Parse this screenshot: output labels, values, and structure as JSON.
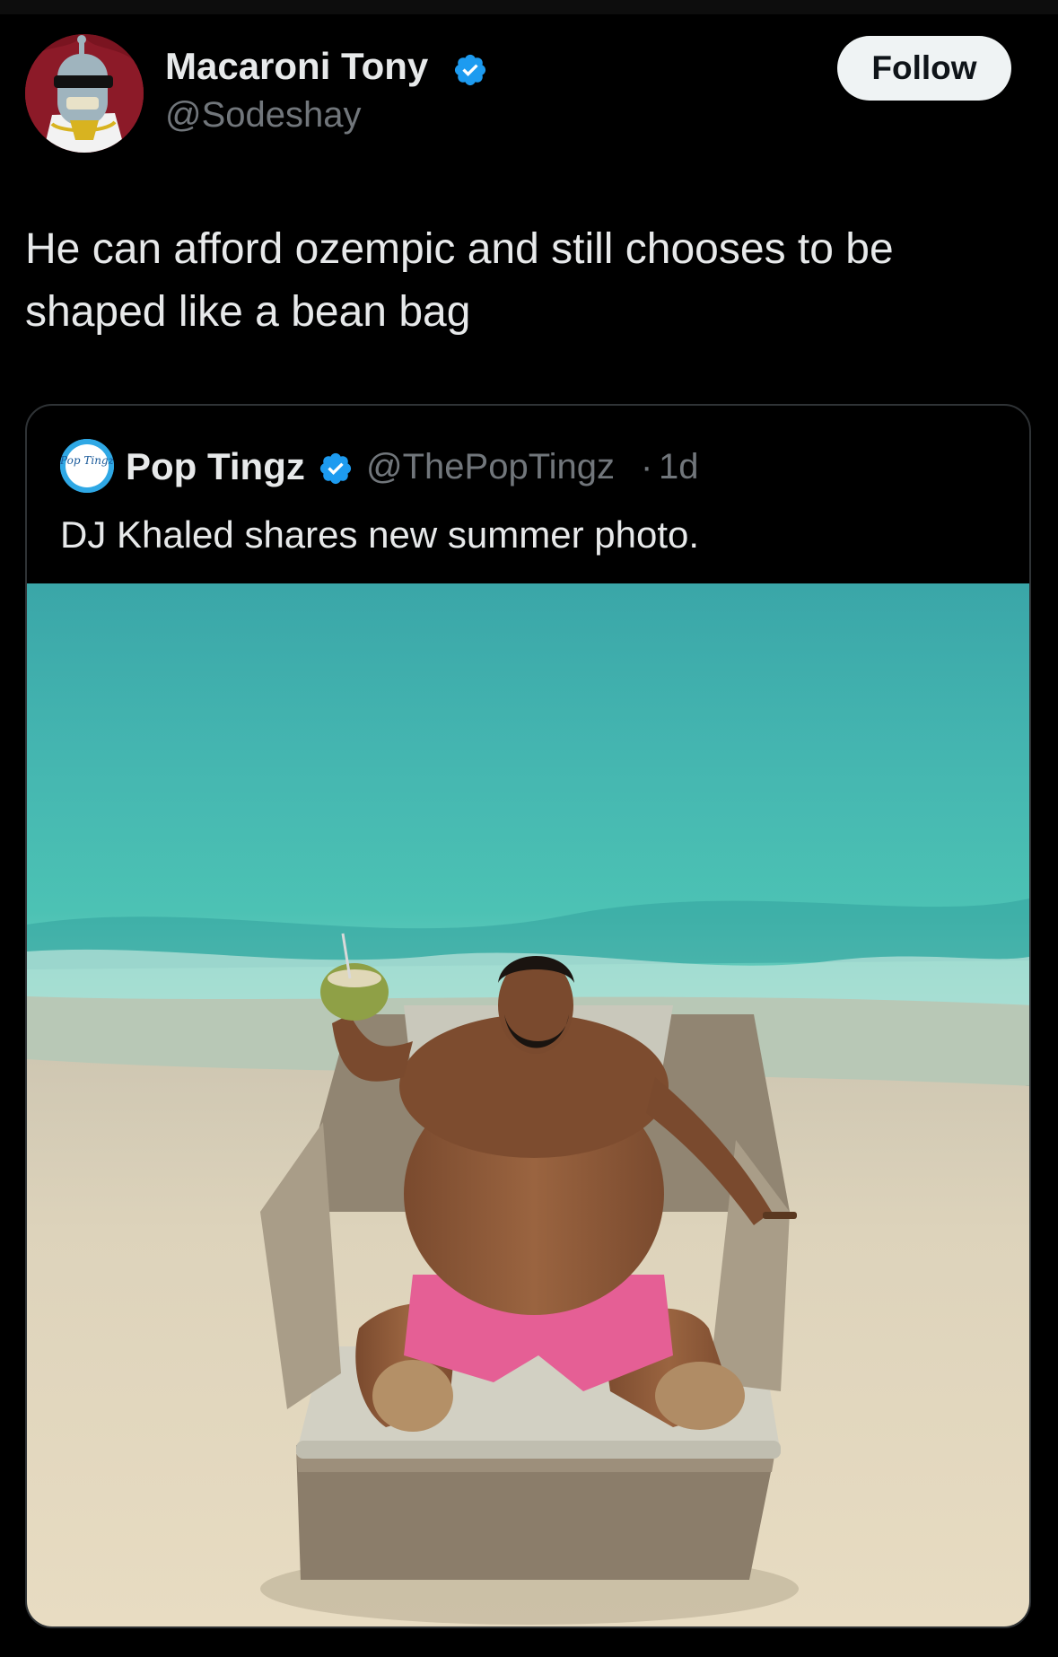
{
  "author": {
    "display_name": "Macaroni Tony",
    "handle": "@Sodeshay",
    "verified": true,
    "avatar_icon": "robot-avatar"
  },
  "follow_button": {
    "label": "Follow"
  },
  "tweet": {
    "text": "He can afford ozempic and still chooses to be shaped like a bean bag"
  },
  "quoted_tweet": {
    "display_name": "Pop Tingz",
    "handle": "@ThePopTingz",
    "separator": "·",
    "time": "1d",
    "verified": true,
    "avatar_icon": "pop-tingz-logo",
    "avatar_text": "Pop Tingz",
    "text": "DJ Khaled shares new summer photo.",
    "media": "beach-lounge-chair-photo"
  },
  "colors": {
    "background": "#000000",
    "verified_blue": "#1d9bf0",
    "handle_gray": "#71767b",
    "follow_bg": "#eff3f4"
  }
}
